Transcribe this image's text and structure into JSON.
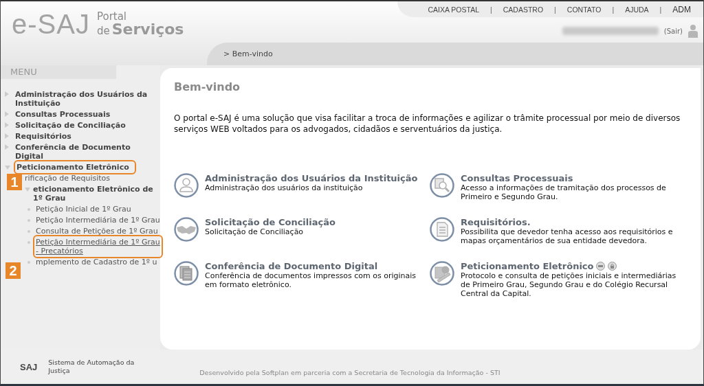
{
  "header": {
    "logo": "e-SAJ",
    "portal_line1": "Portal",
    "portal_line2a": "de",
    "portal_line2b": "Serviços",
    "nav": [
      "CAIXA POSTAL",
      "CADASTRO",
      "CONTATO",
      "AJUDA"
    ],
    "nav_separator": "|",
    "role": "ADM",
    "logout": "(Sair)"
  },
  "breadcrumb": "> Bem-vindo",
  "menu": {
    "title": "MENU",
    "items": [
      {
        "label": "Administração dos Usuários da Instituição",
        "expanded": false
      },
      {
        "label": "Consultas Processuais",
        "expanded": false
      },
      {
        "label": "Solicitação de Conciliação",
        "expanded": false
      },
      {
        "label": "Requisitórios",
        "expanded": false
      },
      {
        "label": "Conferência de Documento Digital",
        "expanded": false
      },
      {
        "label": "Peticionamento Eletrônico",
        "expanded": true,
        "callout": "1",
        "children": [
          {
            "label": "rificação de Requisitos"
          },
          {
            "label": "eticionamento Eletrônico de 1º Grau",
            "expanded": true,
            "children": [
              {
                "label": "Petição Inicial de 1º Grau",
                "selected": false
              },
              {
                "label": "Petição Intermediária de 1º Grau",
                "selected": false
              },
              {
                "label": "Consulta de Petições de 1º Grau",
                "selected": false
              },
              {
                "label": "Petição Intermediária de 1º Grau - Precatórios",
                "selected": true,
                "callout": "2"
              },
              {
                "label": "mplemento de Cadastro de 1º u",
                "selected": false
              }
            ]
          }
        ]
      }
    ]
  },
  "page": {
    "title": "Bem-vindo",
    "intro": "O portal e-SAJ é uma solução que visa facilitar a troca de informações e agilizar o trâmite processual por meio de diversos serviços WEB voltados para os advogados, cidadãos e serventuários da justiça.",
    "services": [
      {
        "title": "Administração dos Usuários da Instituição",
        "description": "Administração dos usuários da instituição"
      },
      {
        "title": "Consultas Processuais",
        "description": "Acesso a informações de tramitação dos processos de Primeiro e Segundo Grau."
      },
      {
        "title": "Solicitação de Conciliação",
        "description": "Solicitação de Conciliação"
      },
      {
        "title": "Requisitórios.",
        "description": "Possibilita que devedor tenha acesso aos requisitórios e mapas orçamentários de sua entidade devedora."
      },
      {
        "title": "Conferência de Documento Digital",
        "description": "Conferência de documentos impressos com os originais em formato eletrônico."
      },
      {
        "title": "Peticionamento Eletrônico",
        "description": "Protocolo e consulta de petições iniciais e intermediárias de Primeiro Grau, Segundo Grau e do Colégio Recursal Central da Capital."
      }
    ]
  },
  "footer": {
    "logo": "SAJ",
    "system": "Sistema de Automação da Justiça",
    "credits": "Desenvolvido pela Softplan em parceria com a Secretaria de Tecnologia da Informação - STI"
  }
}
